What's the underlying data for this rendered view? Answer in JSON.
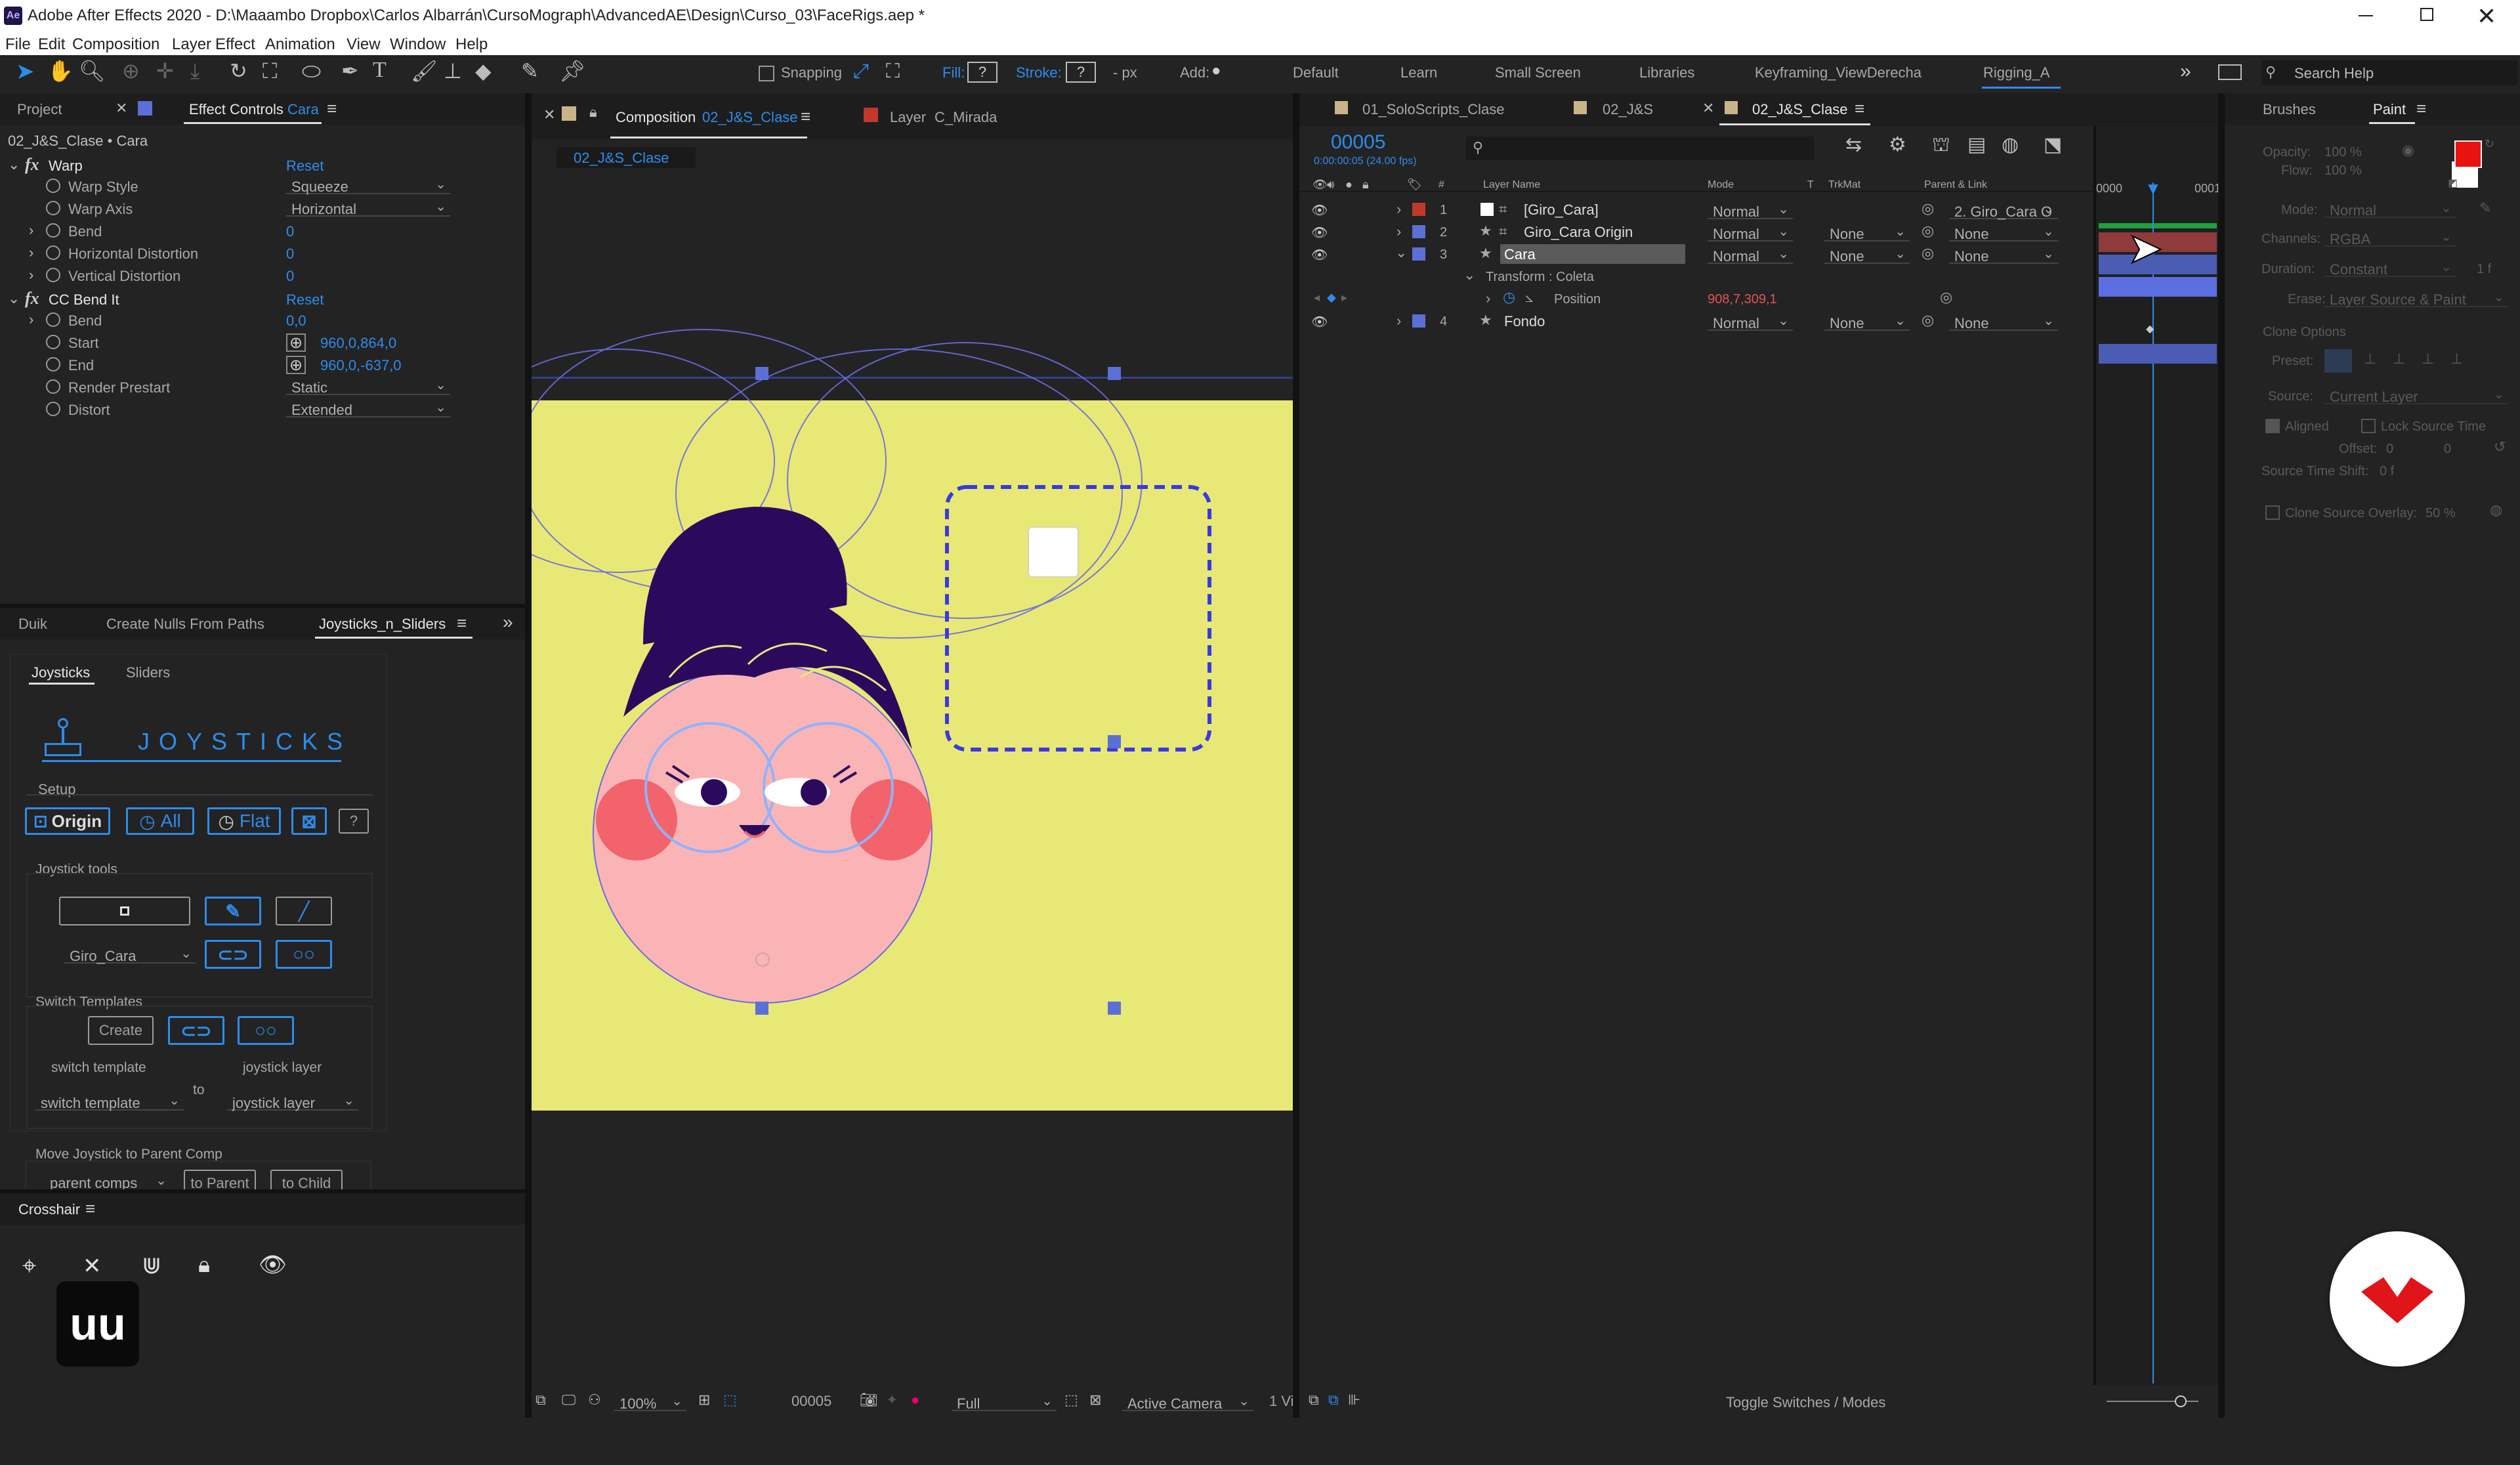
{
  "window": {
    "app_icon": "Ae",
    "title": "Adobe After Effects 2020 - D:\\Maaambo Dropbox\\Carlos Albarrán\\CursoMograph\\AdvancedAE\\Design\\Curso_03\\FaceRigs.aep *"
  },
  "menu": [
    "File",
    "Edit",
    "Composition",
    "Layer",
    "Effect",
    "Animation",
    "View",
    "Window",
    "Help"
  ],
  "toolbar": {
    "snapping": "Snapping",
    "fill": "Fill:",
    "fill_val": "?",
    "stroke": "Stroke:",
    "stroke_val": "?",
    "px": "- px",
    "add": "Add:"
  },
  "workspaces": [
    "Default",
    "Learn",
    "Small Screen",
    "Libraries",
    "Keyframing_ViewDerecha",
    "Rigging_A"
  ],
  "search_help": "Search Help",
  "left_panel": {
    "tabs": {
      "project": "Project",
      "effect_controls": "Effect Controls",
      "target": "Cara"
    },
    "subtitle": "02_J&S_Clase • Cara",
    "fx1": {
      "name": "Warp",
      "reset": "Reset"
    },
    "props1": [
      {
        "label": "Warp Style",
        "value": "Squeeze"
      },
      {
        "label": "Warp Axis",
        "value": "Horizontal"
      },
      {
        "label": "Bend",
        "value": "0"
      },
      {
        "label": "Horizontal Distortion",
        "value": "0"
      },
      {
        "label": "Vertical Distortion",
        "value": "0"
      }
    ],
    "fx2": {
      "name": "CC Bend It",
      "reset": "Reset"
    },
    "props2": [
      {
        "label": "Bend",
        "value": "0,0"
      },
      {
        "label": "Start",
        "value": "960,0,864,0"
      },
      {
        "label": "End",
        "value": "960,0,-637,0"
      },
      {
        "label": "Render Prestart",
        "value": "Static"
      },
      {
        "label": "Distort",
        "value": "Extended"
      }
    ]
  },
  "script_panel": {
    "tabs": [
      "Duik",
      "Create Nulls From Paths",
      "Joysticks_n_Sliders"
    ],
    "subtabs": [
      "Joysticks",
      "Sliders"
    ],
    "logo_text": "JOYSTICKS",
    "setup_label": "Setup",
    "setup_buttons": [
      "Origin",
      "All",
      "Flat",
      "?"
    ],
    "joystick_tools_label": "Joystick tools",
    "giro_cara": "Giro_Cara",
    "switch_templates_label": "Switch Templates",
    "create": "Create",
    "switch_template_label": "switch template",
    "joystick_layer_label": "joystick layer",
    "to": "to",
    "switch_template_dd": "switch template",
    "joystick_layer_dd": "joystick layer",
    "move_label": "Move Joystick to Parent Comp",
    "parent_comps": "parent comps",
    "to_parent": "to Parent",
    "to_child": "to Child"
  },
  "crosshair_panel": {
    "title": "Crosshair",
    "badge": "uu"
  },
  "comp_panel": {
    "tab_comp": "Composition",
    "comp_name": "02_J&S_Clase",
    "tab_layer": "Layer",
    "layer_name": "C_Mirada",
    "breadcrumb": "02_J&S_Clase",
    "zoom": "100%",
    "timecode": "00005",
    "resolution": "Full",
    "camera": "Active Camera",
    "views": "1 Vi"
  },
  "timeline": {
    "tabs": [
      "01_SoloScripts_Clase",
      "02_J&S",
      "02_J&S_Clase"
    ],
    "timecode": "00005",
    "timecode_sub": "0:00:00:05 (24.00 fps)",
    "columns": {
      "layer_name": "Layer Name",
      "mode": "Mode",
      "t": "T",
      "trkmat": "TrkMat",
      "parent": "Parent & Link"
    },
    "layers": [
      {
        "num": "1",
        "name": "[Giro_Cara]",
        "color": "#c0392b",
        "mode": "Normal",
        "trkmat": "",
        "parent": "2. Giro_Cara O"
      },
      {
        "num": "2",
        "name": "Giro_Cara Origin",
        "color": "#5c6fd6",
        "mode": "Normal",
        "trkmat": "None",
        "parent": "None"
      },
      {
        "num": "3",
        "name": "Cara",
        "color": "#5c6fd6",
        "mode": "Normal",
        "trkmat": "None",
        "parent": "None"
      },
      {
        "num": "4",
        "name": "Fondo",
        "color": "#5c6fd6",
        "mode": "Normal",
        "trkmat": "None",
        "parent": "None"
      }
    ],
    "transform": "Transform : Coleta",
    "position_label": "Position",
    "position_value": "908,7,309,1",
    "ruler": [
      "0000",
      "0001"
    ],
    "toggle": "Toggle Switches / Modes"
  },
  "right_panel": {
    "tabs": [
      "Brushes",
      "Paint"
    ],
    "opacity": "Opacity:",
    "opacity_val": "100 %",
    "flow": "Flow:",
    "flow_val": "100 %",
    "mode": "Mode:",
    "mode_val": "Normal",
    "channels": "Channels:",
    "channels_val": "RGBA",
    "duration": "Duration:",
    "duration_val": "Constant",
    "duration_num": "1 f",
    "erase": "Erase:",
    "erase_val": "Layer Source & Paint",
    "clone_options": "Clone Options",
    "preset": "Preset:",
    "source": "Source:",
    "source_val": "Current Layer",
    "aligned": "Aligned",
    "lock_source": "Lock Source Time",
    "offset": "Offset:",
    "offset_val": "0",
    "offset_val2": "0",
    "source_shift": "Source Time Shift:",
    "source_shift_val": "0 f",
    "clone_overlay": "Clone Source Overlay:",
    "clone_overlay_val": "50 %",
    "fg_color": "#e8120f",
    "bg_color": "#ffffff"
  },
  "colors": {
    "accent": "#2d8ceb",
    "canvas": "#e8e877"
  }
}
